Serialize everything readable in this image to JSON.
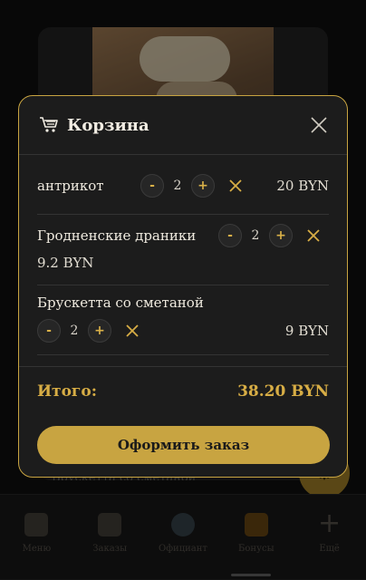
{
  "background": {
    "caption": "Брускетта со сметаной",
    "nav": [
      {
        "label": "Меню",
        "icon": "menu-plate-icon"
      },
      {
        "label": "Заказы",
        "icon": "orders-box-icon"
      },
      {
        "label": "Официант",
        "icon": "waiter-icon"
      },
      {
        "label": "Бонусы",
        "icon": "gift-icon"
      },
      {
        "label": "Ещё",
        "icon": "plus-icon"
      }
    ]
  },
  "cart": {
    "title": "Корзина",
    "items": [
      {
        "name": "антрикот",
        "minus": "-",
        "qty": "2",
        "plus": "+",
        "price": "20 BYN"
      },
      {
        "name": "Гродненские драники",
        "minus": "-",
        "qty": "2",
        "plus": "+",
        "price": "9.2 BYN"
      },
      {
        "name": "Брускетта со сметаной",
        "minus": "-",
        "qty": "2",
        "plus": "+",
        "price": "9 BYN"
      }
    ],
    "total_label": "Итого:",
    "total_value": "38.20 BYN",
    "checkout_label": "Оформить заказ"
  },
  "colors": {
    "accent": "#c8a441",
    "modal_bg": "#1c1c1c",
    "page_bg": "#0d0d0d"
  }
}
